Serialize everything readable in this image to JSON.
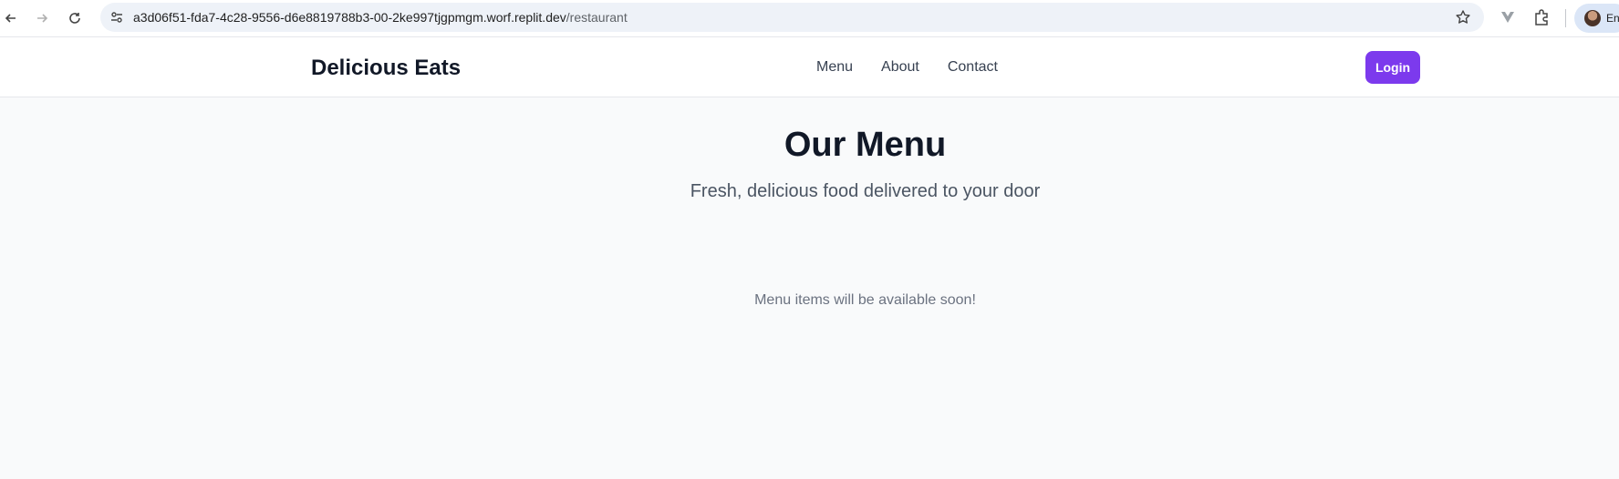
{
  "browser": {
    "url_host": "a3d06f51-fda7-4c28-9556-d6e8819788b3-00-2ke997tjgpmgm.worf.replit.dev",
    "url_path": "/restaurant",
    "profile_label": "En"
  },
  "header": {
    "brand": "Delicious Eats",
    "nav": [
      "Menu",
      "About",
      "Contact"
    ],
    "login_label": "Login"
  },
  "main": {
    "title": "Our Menu",
    "subtitle": "Fresh, delicious food delivered to your door",
    "empty_message": "Menu items will be available soon!"
  },
  "colors": {
    "accent": "#7c3aed",
    "page_bg": "#f9fafb"
  }
}
